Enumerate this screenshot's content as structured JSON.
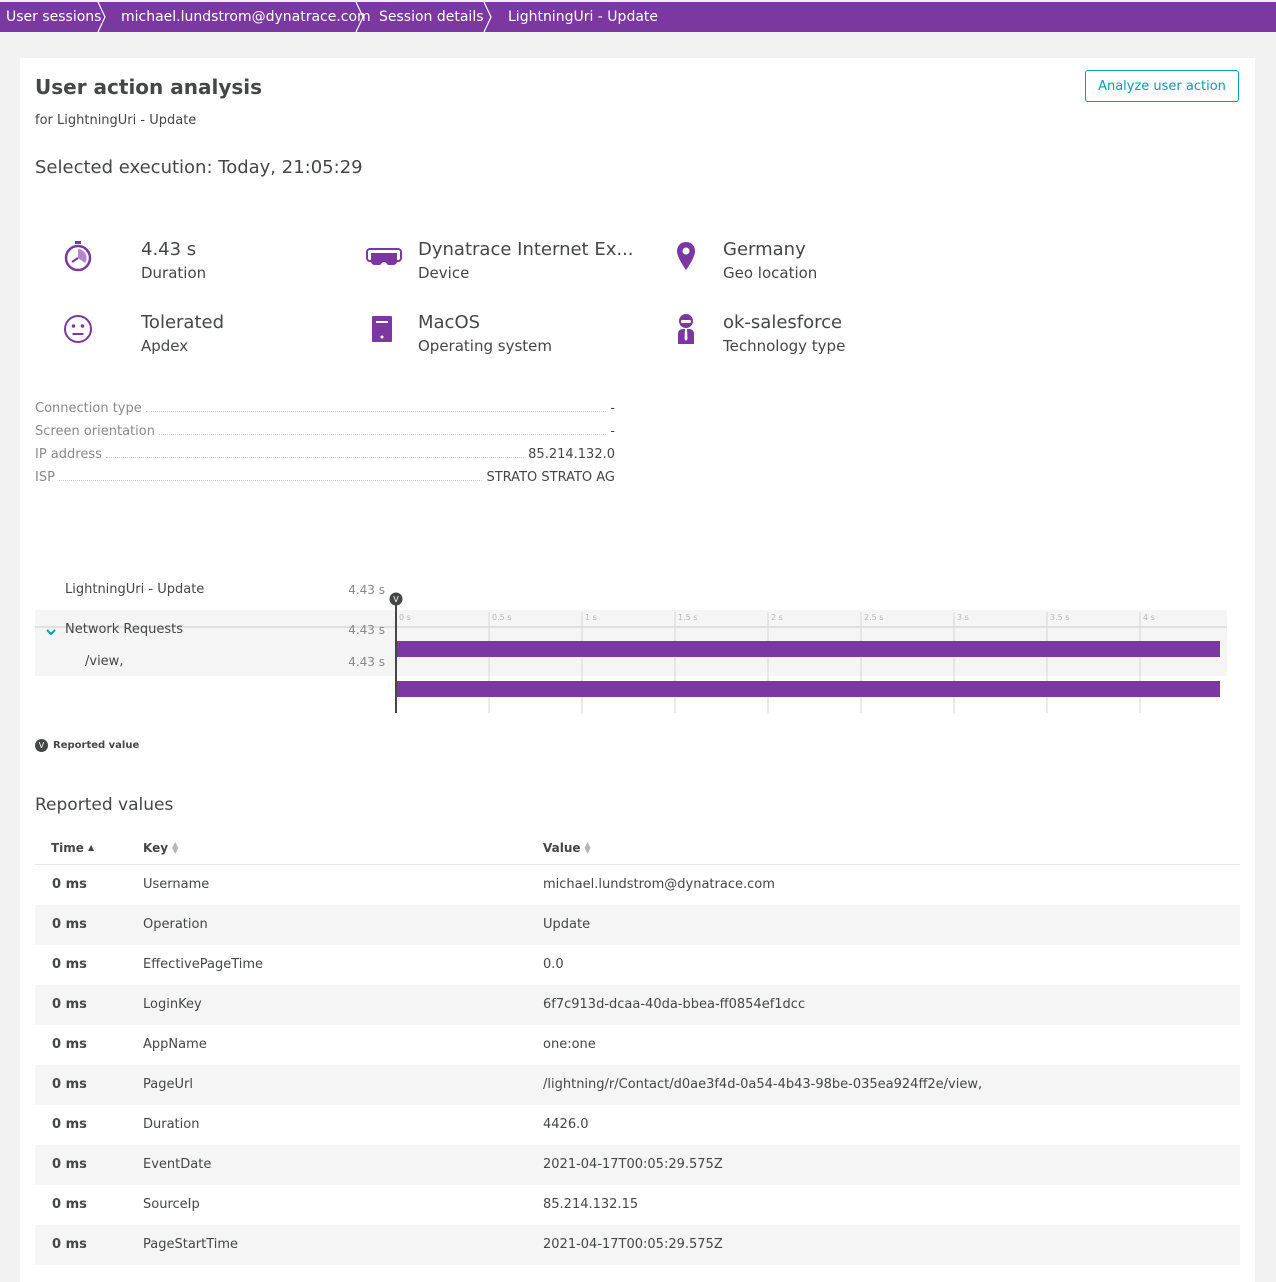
{
  "breadcrumb": {
    "items": [
      {
        "label": "User sessions"
      },
      {
        "label": "michael.lundstrom@dynatrace.com"
      },
      {
        "label": "Session details"
      },
      {
        "label": "LightningUri - Update"
      }
    ]
  },
  "header": {
    "title": "User action analysis",
    "subtitle": "for LightningUri - Update",
    "analyze_button": "Analyze user action",
    "selected_execution": "Selected execution: Today, 21:05:29"
  },
  "tiles": [
    {
      "icon": "stopwatch-icon",
      "value": "4.43 s",
      "label": "Duration"
    },
    {
      "icon": "headset-device-icon",
      "value": "Dynatrace Internet Ex...",
      "label": "Device"
    },
    {
      "icon": "location-pin-icon",
      "value": "Germany",
      "label": "Geo location"
    },
    {
      "icon": "neutral-face-icon",
      "value": "Tolerated",
      "label": "Apdex"
    },
    {
      "icon": "os-document-icon",
      "value": "MacOS",
      "label": "Operating system"
    },
    {
      "icon": "technology-agent-icon",
      "value": "ok-salesforce",
      "label": "Technology type"
    }
  ],
  "properties": [
    {
      "key": "Connection type",
      "value": "-"
    },
    {
      "key": "Screen orientation",
      "value": "-"
    },
    {
      "key": "IP address",
      "value": "85.214.132.0"
    },
    {
      "key": "ISP",
      "value": "STRATO STRATO AG"
    }
  ],
  "waterfall": {
    "marker_letter": "V",
    "axis_ticks": [
      "0 s",
      "0.5 s",
      "1 s",
      "1.5 s",
      "2 s",
      "2.5 s",
      "3 s",
      "3.5 s",
      "4 s"
    ],
    "axis_max_seconds": 4.43,
    "rows": [
      {
        "label": "LightningUri - Update",
        "duration": "4.43 s",
        "start": 0,
        "end": 4.43,
        "color": "#7c38a1"
      },
      {
        "label": "Network Requests",
        "duration": "4.43 s",
        "start": 0,
        "end": 4.43,
        "color": "#7c38a1"
      },
      {
        "label": "/view,",
        "duration": "4.43 s",
        "start": 0,
        "end": 4.43,
        "color": "#e8c000"
      }
    ]
  },
  "legend": {
    "marker": "V",
    "label": "Reported value"
  },
  "reported_values": {
    "title": "Reported values",
    "columns": {
      "time": "Time",
      "key": "Key",
      "value": "Value"
    },
    "rows": [
      {
        "time": "0 ms",
        "key": "Username",
        "value": "michael.lundstrom@dynatrace.com"
      },
      {
        "time": "0 ms",
        "key": "Operation",
        "value": "Update"
      },
      {
        "time": "0 ms",
        "key": "EffectivePageTime",
        "value": "0.0"
      },
      {
        "time": "0 ms",
        "key": "LoginKey",
        "value": "6f7c913d-dcaa-40da-bbea-ff0854ef1dcc"
      },
      {
        "time": "0 ms",
        "key": "AppName",
        "value": "one:one"
      },
      {
        "time": "0 ms",
        "key": "PageUrl",
        "value": "/lightning/r/Contact/d0ae3f4d-0a54-4b43-98be-035ea924ff2e/view,"
      },
      {
        "time": "0 ms",
        "key": "Duration",
        "value": "4426.0"
      },
      {
        "time": "0 ms",
        "key": "EventDate",
        "value": "2021-04-17T00:05:29.575Z"
      },
      {
        "time": "0 ms",
        "key": "SourceIp",
        "value": "85.214.132.15"
      },
      {
        "time": "0 ms",
        "key": "PageStartTime",
        "value": "2021-04-17T00:05:29.575Z"
      }
    ]
  },
  "colors": {
    "brand": "#7c38a1",
    "accent": "#00a1b2",
    "network_bar": "#e8c000"
  }
}
